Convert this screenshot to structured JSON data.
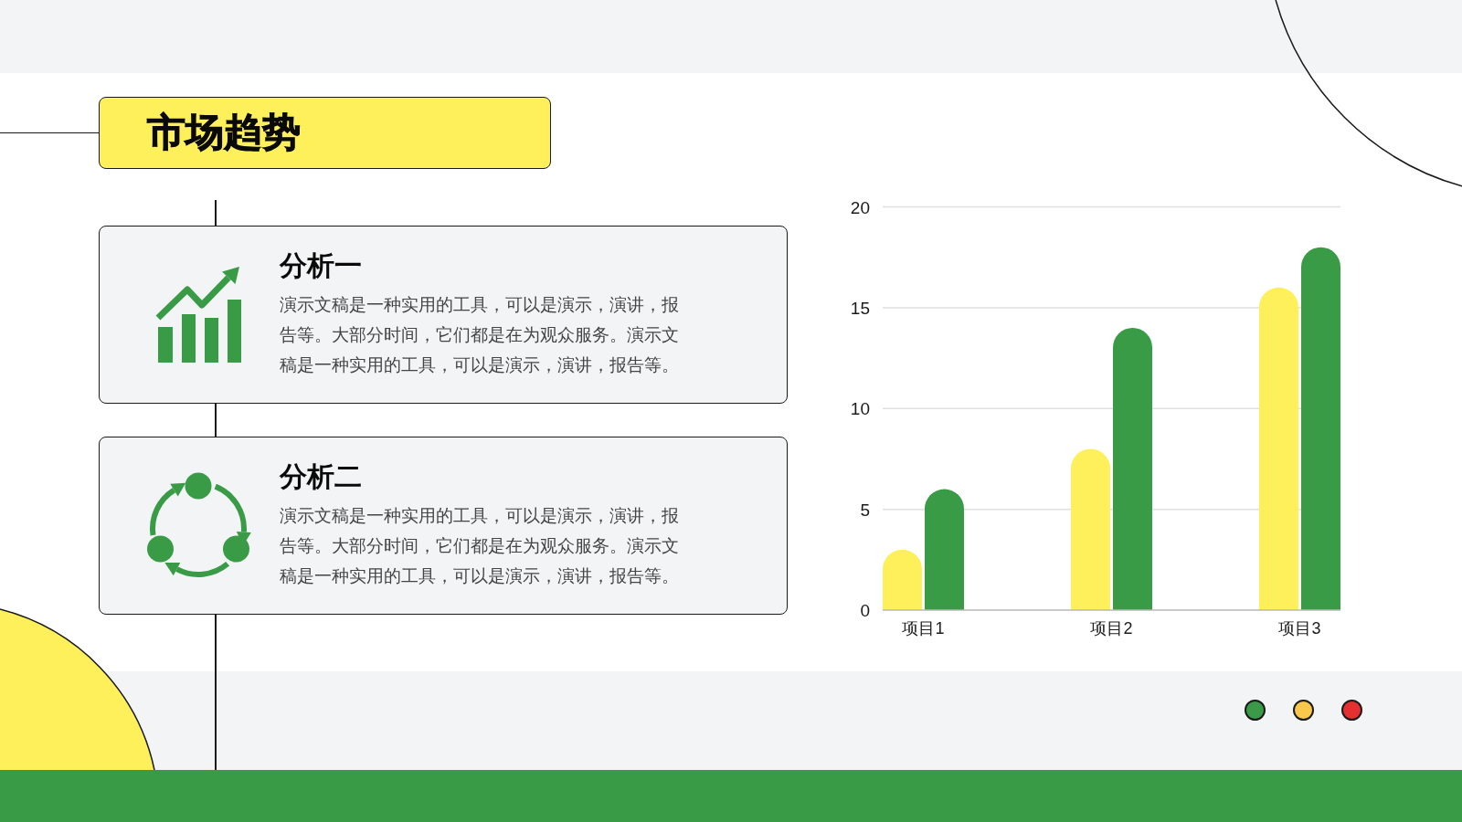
{
  "title": "市场趋势",
  "cards": [
    {
      "kind": "growth",
      "heading": "分析一",
      "body": "演示文稿是一种实用的工具，可以是演示，演讲，报告等。大部分时间，它们都是在为观众服务。演示文稿是一种实用的工具，可以是演示，演讲，报告等。"
    },
    {
      "kind": "cycle",
      "heading": "分析二",
      "body": "演示文稿是一种实用的工具，可以是演示，演讲，报告等。大部分时间，它们都是在为观众服务。演示文稿是一种实用的工具，可以是演示，演讲，报告等。"
    }
  ],
  "chart": {
    "chart_data": {
      "type": "bar",
      "categories": [
        "项目1",
        "项目2",
        "项目3"
      ],
      "series": [
        {
          "color": "#fef05a",
          "values": [
            3,
            8,
            16
          ]
        },
        {
          "color": "#3a9b47",
          "values": [
            6,
            14,
            18
          ]
        }
      ],
      "ylim": [
        0,
        20
      ],
      "yticks": [
        0,
        5,
        10,
        15,
        20
      ],
      "grid": true
    }
  },
  "dots": [
    {
      "color": "#3a9a48"
    },
    {
      "color": "#f9c84b"
    },
    {
      "color": "#e53031"
    }
  ]
}
